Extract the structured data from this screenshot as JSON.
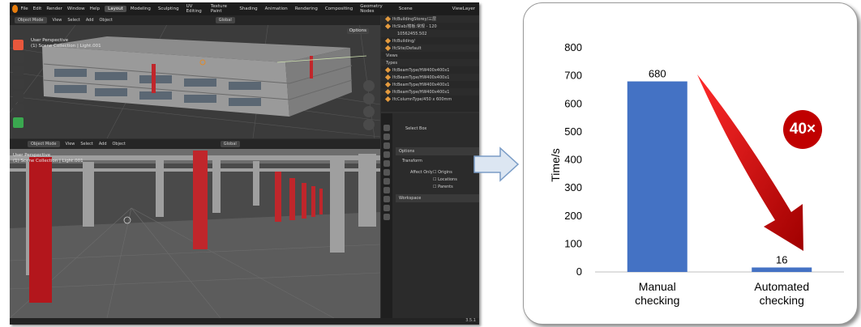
{
  "blender": {
    "logo": "blender-logo-icon",
    "menu": [
      "File",
      "Edit",
      "Render",
      "Window",
      "Help"
    ],
    "workspaces": [
      "Layout",
      "Modeling",
      "Sculpting",
      "UV Editing",
      "Texture Paint",
      "Shading",
      "Animation",
      "Rendering",
      "Compositing",
      "Geometry Nodes"
    ],
    "active_workspace": "Layout",
    "scene": "Scene",
    "view_layer": "ViewLayer",
    "viewport_top": {
      "mode": "Object Mode",
      "menus": [
        "View",
        "Select",
        "Add",
        "Object"
      ],
      "orientation": "Global",
      "options": "Options",
      "perspective": "User Perspective",
      "collection": "(1) Scene Collection | Light.001"
    },
    "viewport_bottom": {
      "mode": "Object Mode",
      "menus": [
        "View",
        "Select",
        "Add",
        "Object"
      ],
      "orientation": "Global",
      "perspective": "User Perspective",
      "collection": "(1) Scene Collection | Light.001"
    },
    "outliner": [
      "IfcBuildingStorey/三层",
      "IfcSlab/楼板:常规 - 120",
      "10562455.502",
      "IfcBuilding/",
      "IfcSite/Default",
      "Views",
      "Types",
      "IfcBeamType/HW400x400x1",
      "IfcBeamType/HW400x400x1",
      "IfcBeamType/HW400x400x1",
      "IfcBeamType/HW400x400x1",
      "IfcColumnType/450 x 600mm"
    ],
    "properties": {
      "tool": "Select Box",
      "options": "Options",
      "transform": "Transform",
      "affect_only": "Affect Only",
      "checks": [
        "Origins",
        "Locations",
        "Parents"
      ],
      "workspace": "Workspace"
    },
    "version": "3.5.1"
  },
  "chart_data": {
    "type": "bar",
    "categories": [
      "Manual checking",
      "Automated checking"
    ],
    "category_lines": [
      [
        "Manual",
        "checking"
      ],
      [
        "Automated",
        "checking"
      ]
    ],
    "values": [
      680,
      16
    ],
    "ylabel": "Time/s",
    "ylim": [
      0,
      800
    ],
    "yticks": [
      0,
      100,
      200,
      300,
      400,
      500,
      600,
      700,
      800
    ],
    "bar_color": "#4472c4",
    "grid": false,
    "annotation": "40×",
    "annotation_color": "#c00000"
  }
}
